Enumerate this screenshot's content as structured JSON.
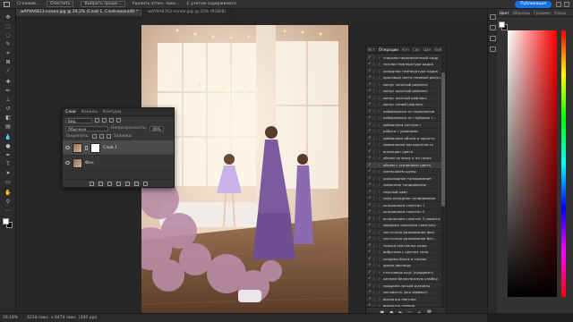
{
  "options_bar": {
    "item1": "Сглажив...",
    "item2": "Очистить",
    "item3": "Выбрать предм...",
    "item4": "Удалить отпеч. пикс...",
    "item5": "С учетом содержимого",
    "publish_label": "Публикация"
  },
  "tabs": [
    {
      "label": "wAY9A6813 копия.jpg @ 29,2% (Слой 1, Слой-маска/8) *"
    },
    {
      "label": "wAY9A6763 копия.jpg @ 25% (RGB/8)"
    }
  ],
  "layers_panel": {
    "tabs": [
      "Слои",
      "Каналы",
      "Контуры"
    ],
    "filter": "Вид",
    "blend_mode": "Обычные",
    "opacity_label": "Непрозрачность:",
    "opacity_value": "40%",
    "lock_label": "Закрепить:",
    "fill_label": "Заливка:",
    "layers": [
      {
        "name": "Слой 1"
      },
      {
        "name": "Фон"
      }
    ]
  },
  "actions_panel": {
    "tabs": [
      "Ист",
      "Операции",
      "Кэп",
      "Сво",
      "Цве",
      "Биб"
    ],
    "items": [
      "спасаем пересвеченный кадр",
      "теплая температура кадра",
      "холодная температура кадра",
      "красивый свето-теневой рисун.",
      "минус зеленый рефлекс",
      "минус красный рефлекс",
      "минус желтый рефлекс",
      "минус синий рефлекс",
      "избавляемся от пересветов",
      "избавляемся от глубоких т...",
      "добавляем контраст",
      "работа с уровнями",
      "добавляем объем и яркость",
      "правильная насыщенность",
      "аннекдон цвета",
      "объем по фону и на героя",
      "объем с усилением цвета",
      "уменьшаем шумы",
      "шоколадное тонирование",
      "лимонное тонирование",
      "нежный цвет",
      "серо-холодное тонирование",
      "исправляем сэмптон 1",
      "исправляем сэмптон 2",
      "исправляем сэмптон 3 (заметн.)",
      "придаем свечение сэмптону",
      "частичное размывание фон",
      "частичное размывание без...",
      "только светлячки кожи",
      "вибртаем с цветом тела",
      "создаем блеск в глазах",
      "яркие ресницы",
      "стесняешь вкус (градиент)",
      "делаем белоснежную улыбку",
      "придаем легкий румянец",
      "матовость (эко эффект)",
      "винаятка светлая",
      "виньетка темная",
      "увеличение резкость",
      "резкость с усилением конт..."
    ]
  },
  "right_panel": {
    "tabs": [
      "Цвет",
      "Образцы",
      "Градиен",
      "Узоры"
    ]
  },
  "status": {
    "zoom": "29,18%",
    "size": "4218 пикс. x 6474 пикс. (300 ppi)"
  },
  "colors": {
    "accent": "#1473e6",
    "panel_bg": "#323232",
    "app_bg": "#1e1e1e"
  }
}
